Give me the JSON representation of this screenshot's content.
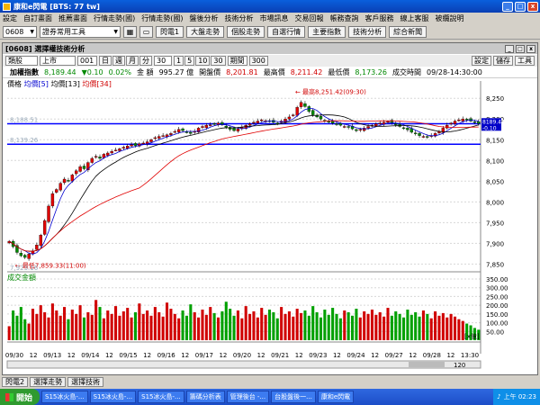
{
  "window": {
    "title": "康和e閃電 [BTS: 77 tw]"
  },
  "menu": [
    "設定",
    "自訂畫面",
    "推薦畫面",
    "行情走勢(國)",
    "行情走勢(國)",
    "盤後分析",
    "技術分析",
    "市場訊息",
    "交易回報",
    "帳務查詢",
    "客戶服務",
    "線上客服",
    "被纜說明"
  ],
  "toolbar": {
    "code": "0608",
    "tool_select": "證券常用工具",
    "buttons": [
      "閃電1",
      "大盤走勢",
      "個股走勢",
      "自選行情",
      "主要指數",
      "技術分析",
      "綜合新聞"
    ]
  },
  "chart_window": {
    "title": "[0608] 選擇權技術分析"
  },
  "controls": {
    "category": "類股",
    "market": "上市",
    "code": "001",
    "periods": [
      "日",
      "週",
      "月",
      "分"
    ],
    "min_value": "30",
    "steps": [
      "1",
      "5",
      "10",
      "30"
    ],
    "active_period": "期間",
    "bars": "300",
    "right_buttons": [
      "設定",
      "儲存",
      "工具"
    ]
  },
  "info": {
    "name": "加權指數",
    "price": "8,189.44",
    "change": "▼0.10",
    "pct": "0.02%",
    "amt_label": "金  額",
    "amt": "995.27 億",
    "open_label": "開盤價",
    "open": "8,201.81",
    "high_label": "最高價",
    "high": "8,211.42",
    "low_label": "最低價",
    "low": "8,173.26",
    "time_label": "成交時間",
    "time": "09/28-14:30:00"
  },
  "legend": {
    "label": "價格",
    "ma1": "均價[5]",
    "ma2": "均價[13]",
    "ma3": "均價[34]"
  },
  "volume_legend": "成交金額",
  "annotations": {
    "hline1": "8,188.51",
    "hline2": "8,139.26",
    "low_label": "最低7,859.33(11:00)",
    "high_label": "最高8,251.42(09:30)",
    "bottom_left": "7,923.16",
    "price_tag": "8189.44",
    "price_tag2": "-0.10",
    "bars_shown": "120",
    "xunit": "[x億]"
  },
  "bottom_tabs": [
    "閃電2",
    "選擇走勢",
    "選擇技術"
  ],
  "taskbar": {
    "start": "開始",
    "items": [
      "S15冰火島-...",
      "S15冰火島-...",
      "S15冰火島-...",
      "籌碼分析表",
      "管理後台 -...",
      "台股盤後一...",
      "康和e閃電"
    ],
    "clock": "上午 02:23"
  },
  "colors": {
    "up": "#e00000",
    "down": "#008800",
    "ma5": "#0000d0",
    "ma13": "#000000",
    "ma34": "#e00000",
    "hline": "#0000ff",
    "vol_up": "#d00000",
    "vol_down": "#00a000"
  },
  "chart_data": {
    "type": "candlestick",
    "price_ylim": [
      7840,
      8270
    ],
    "price_ticks": [
      7850,
      7900,
      7950,
      8000,
      8050,
      8100,
      8150,
      8200,
      8250
    ],
    "vol_ylim": [
      0,
      350
    ],
    "vol_ticks": [
      50,
      100,
      150,
      200,
      250,
      300,
      350
    ],
    "x_labels": [
      "09/30",
      "12",
      "09/13",
      "12",
      "09/14",
      "12",
      "09/15",
      "12",
      "09/16",
      "12",
      "09/17",
      "12",
      "09/20",
      "12",
      "09/21",
      "12",
      "09/23",
      "12",
      "09/24",
      "12",
      "09/27",
      "12",
      "09/28",
      "12",
      "13:30"
    ],
    "hlines": [
      8188.51,
      8139.26
    ],
    "close": [
      7905,
      7892,
      7878,
      7870,
      7866,
      7874,
      7882,
      7896,
      7920,
      7955,
      7990,
      8020,
      8030,
      8045,
      8055,
      8050,
      8065,
      8075,
      8085,
      8080,
      8095,
      8105,
      8110,
      8105,
      8115,
      8118,
      8122,
      8125,
      8128,
      8132,
      8135,
      8138,
      8136,
      8140,
      8142,
      8145,
      8150,
      8155,
      8158,
      8160,
      8162,
      8165,
      8170,
      8175,
      8172,
      8168,
      8165,
      8170,
      8178,
      8182,
      8185,
      8186,
      8188,
      8190,
      8186,
      8180,
      8175,
      8172,
      8176,
      8180,
      8185,
      8188,
      8192,
      8195,
      8198,
      8196,
      8194,
      8192,
      8190,
      8195,
      8200,
      8205,
      8210,
      8228,
      8240,
      8230,
      8218,
      8210,
      8205,
      8200,
      8196,
      8192,
      8190,
      8188,
      8185,
      8182,
      8180,
      8176,
      8172,
      8175,
      8178,
      8182,
      8185,
      8188,
      8190,
      8192,
      8194,
      8190,
      8186,
      8182,
      8178,
      8174,
      8168,
      8164,
      8160,
      8158,
      8156,
      8160,
      8165,
      8170,
      8178,
      8185,
      8190,
      8195,
      8198,
      8200,
      8198,
      8195,
      8192,
      8189
    ],
    "volume": [
      80,
      170,
      140,
      190,
      120,
      95,
      180,
      150,
      200,
      160,
      130,
      210,
      170,
      140,
      190,
      120,
      175,
      150,
      200,
      130,
      160,
      145,
      230,
      190,
      125,
      170,
      150,
      195,
      140,
      165,
      185,
      130,
      160,
      210,
      150,
      170,
      140,
      190,
      160,
      135,
      215,
      180,
      150,
      125,
      170,
      140,
      205,
      160,
      130,
      175,
      145,
      190,
      155,
      130,
      165,
      220,
      180,
      140,
      170,
      125,
      195,
      150,
      165,
      130,
      185,
      145,
      175,
      160,
      125,
      190,
      150,
      165,
      135,
      180,
      155,
      170,
      140,
      195,
      160,
      130,
      175,
      145,
      185,
      150,
      125,
      170,
      160,
      140,
      180,
      130,
      165,
      150,
      175,
      145,
      160,
      135,
      185,
      140,
      165,
      150,
      130,
      175,
      145,
      160,
      135,
      170,
      150,
      125,
      165,
      140,
      155,
      130,
      150,
      135,
      120,
      110,
      95,
      85,
      70,
      60
    ]
  }
}
